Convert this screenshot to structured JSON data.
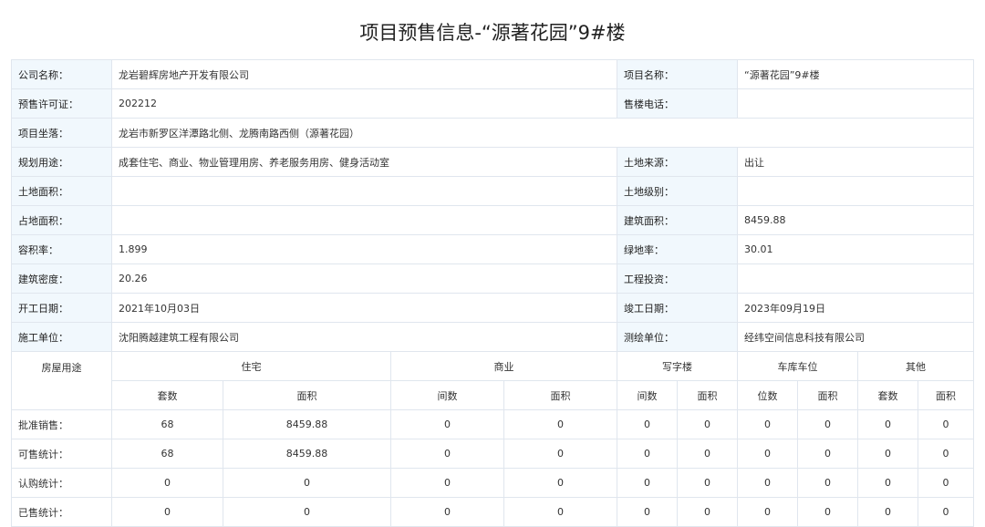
{
  "title": "项目预售信息-“源著花园”9#楼",
  "info": {
    "company_label": "公司名称：",
    "company_value": "龙岩碧辉房地产开发有限公司",
    "project_label": "项目名称：",
    "project_value": "“源著花园”9#楼",
    "permit_label": "预售许可证：",
    "permit_value": "202212",
    "phone_label": "售楼电话：",
    "phone_value": "",
    "location_label": "项目坐落：",
    "location_value": "龙岩市新罗区洋潭路北侧、龙腾南路西侧（源著花园）",
    "usage_label": "规划用途：",
    "usage_value": "成套住宅、商业、物业管理用房、养老服务用房、健身活动室",
    "land_source_label": "土地来源：",
    "land_source_value": "出让",
    "land_area_label": "土地面积：",
    "land_area_value": "",
    "land_grade_label": "土地级别：",
    "land_grade_value": "",
    "occupied_area_label": "占地面积：",
    "occupied_area_value": "",
    "building_area_label": "建筑面积：",
    "building_area_value": "8459.88",
    "plot_ratio_label": "容积率：",
    "plot_ratio_value": "1.899",
    "green_ratio_label": "绿地率：",
    "green_ratio_value": "30.01",
    "density_label": "建筑密度：",
    "density_value": "20.26",
    "investment_label": "工程投资：",
    "investment_value": "",
    "start_date_label": "开工日期：",
    "start_date_value": "2021年10月03日",
    "end_date_label": "竣工日期：",
    "end_date_value": "2023年09月19日",
    "builder_label": "施工单位：",
    "builder_value": "沈阳腾越建筑工程有限公司",
    "surveyor_label": "测绘单位：",
    "surveyor_value": "经纬空间信息科技有限公司"
  },
  "stats": {
    "row_header": "房屋用途",
    "groups": [
      "住宅",
      "商业",
      "写字楼",
      "车库车位",
      "其他"
    ],
    "subheaders": [
      "套数",
      "面积",
      "间数",
      "面积",
      "间数",
      "面积",
      "位数",
      "面积",
      "套数",
      "面积"
    ],
    "rows": [
      {
        "label": "批准销售：",
        "values": [
          "68",
          "8459.88",
          "0",
          "0",
          "0",
          "0",
          "0",
          "0",
          "0",
          "0"
        ]
      },
      {
        "label": "可售统计：",
        "values": [
          "68",
          "8459.88",
          "0",
          "0",
          "0",
          "0",
          "0",
          "0",
          "0",
          "0"
        ]
      },
      {
        "label": "认购统计：",
        "values": [
          "0",
          "0",
          "0",
          "0",
          "0",
          "0",
          "0",
          "0",
          "0",
          "0"
        ]
      },
      {
        "label": "已售统计：",
        "values": [
          "0",
          "0",
          "0",
          "0",
          "0",
          "0",
          "0",
          "0",
          "0",
          "0"
        ]
      }
    ]
  }
}
